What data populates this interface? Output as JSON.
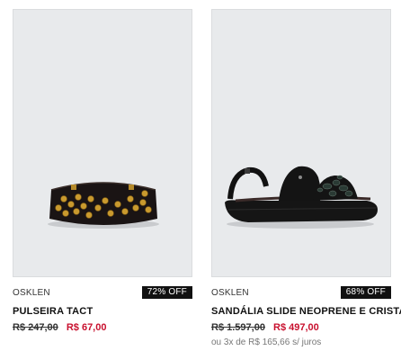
{
  "products": [
    {
      "brand": "OSKLEN",
      "discount": "72% OFF",
      "name": "PULSEIRA TACT",
      "old_price": "R$ 247,00",
      "new_price": "R$ 67,00",
      "image_icon": "studded-bracelet-image"
    },
    {
      "brand": "OSKLEN",
      "discount": "68% OFF",
      "name": "SANDÁLIA SLIDE NEOPRENE E CRISTAIS",
      "old_price": "R$ 1.597,00",
      "new_price": "R$ 497,00",
      "installments": "ou 3x de R$ 165,66 s/ juros",
      "image_icon": "sandal-image"
    }
  ],
  "colors": {
    "image_bg": "#e8eaec",
    "sale_price": "#c8102e",
    "badge_bg": "#111111"
  }
}
